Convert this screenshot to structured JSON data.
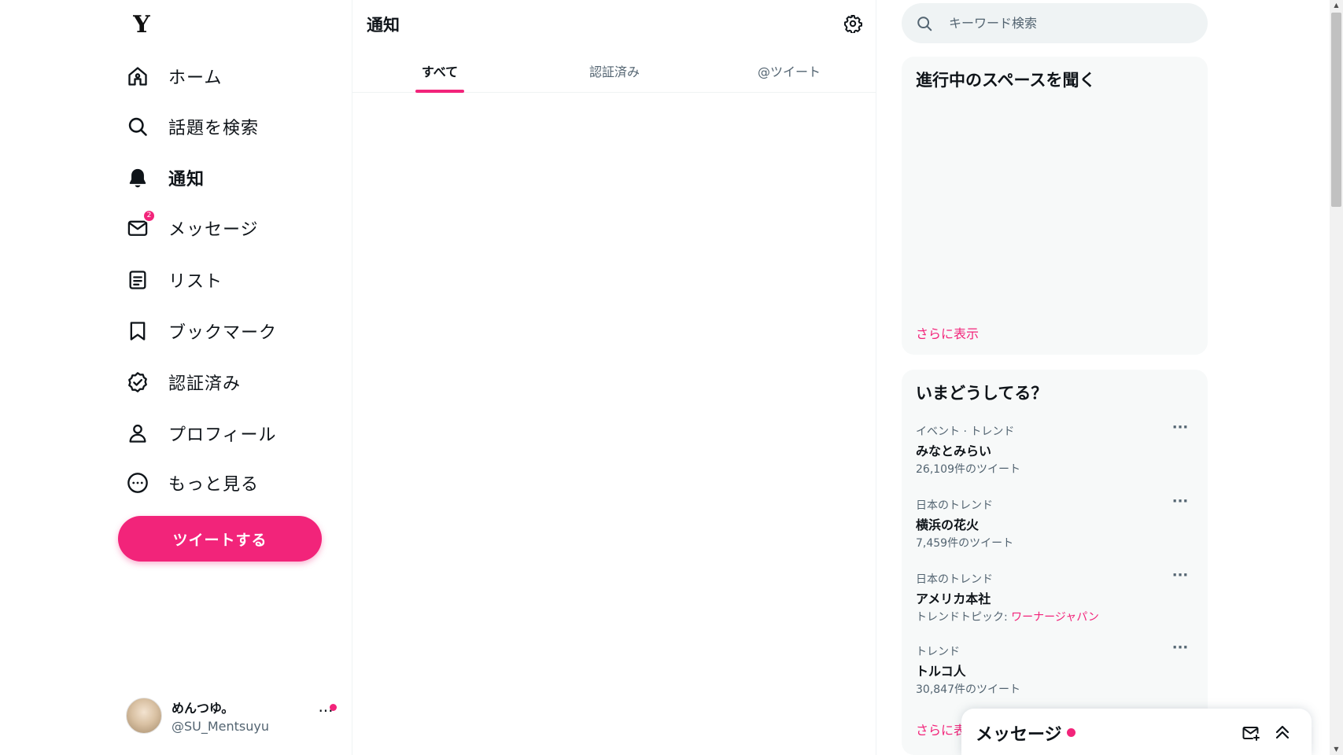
{
  "brand": {
    "logo": "Y",
    "accent_color": "#f2247a"
  },
  "sidebar": {
    "items": [
      {
        "label": "ホーム",
        "icon": "home-icon"
      },
      {
        "label": "話題を検索",
        "icon": "search-icon"
      },
      {
        "label": "通知",
        "icon": "bell-icon",
        "active": true
      },
      {
        "label": "メッセージ",
        "icon": "mail-icon",
        "badge": "2"
      },
      {
        "label": "リスト",
        "icon": "list-icon"
      },
      {
        "label": "ブックマーク",
        "icon": "bookmark-icon"
      },
      {
        "label": "認証済み",
        "icon": "verified-icon"
      },
      {
        "label": "プロフィール",
        "icon": "profile-icon"
      },
      {
        "label": "もっと見る",
        "icon": "more-circle-icon"
      }
    ],
    "tweet_button": "ツイートする",
    "account": {
      "name": "めんつゆ。",
      "handle": "@SU_Mentsuyu",
      "more": "···"
    }
  },
  "main": {
    "title": "通知",
    "tabs": [
      {
        "label": "すべて",
        "active": true
      },
      {
        "label": "認証済み"
      },
      {
        "label": "@ツイート"
      }
    ]
  },
  "right": {
    "search_placeholder": "キーワード検索",
    "spaces": {
      "title": "進行中のスペースを聞く",
      "show_more": "さらに表示"
    },
    "trends": {
      "title": "いまどうしてる？",
      "items": [
        {
          "meta": "イベント · トレンド",
          "name": "みなとみらい",
          "count": "26,109件のツイート"
        },
        {
          "meta": "日本のトレンド",
          "name": "横浜の花火",
          "count": "7,459件のツイート"
        },
        {
          "meta": "日本のトレンド",
          "name": "アメリカ本社",
          "topic_label": "トレンドトピック:",
          "topic_link": "ワーナージャパン"
        },
        {
          "meta": "トレンド",
          "name": "トルコ人",
          "count": "30,847件のツイート"
        }
      ],
      "more_button": "···",
      "show_more": "さらに表示"
    }
  },
  "messages_drawer": {
    "title": "メッセージ"
  }
}
